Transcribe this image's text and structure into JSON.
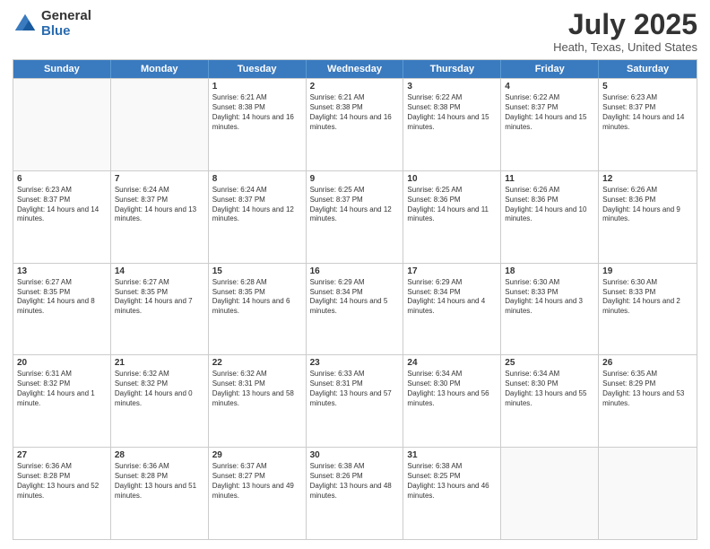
{
  "logo": {
    "general": "General",
    "blue": "Blue"
  },
  "title": {
    "month": "July 2025",
    "location": "Heath, Texas, United States"
  },
  "header": {
    "days": [
      "Sunday",
      "Monday",
      "Tuesday",
      "Wednesday",
      "Thursday",
      "Friday",
      "Saturday"
    ]
  },
  "rows": [
    [
      {
        "day": "",
        "info": "",
        "empty": true
      },
      {
        "day": "",
        "info": "",
        "empty": true
      },
      {
        "day": "1",
        "info": "Sunrise: 6:21 AM\nSunset: 8:38 PM\nDaylight: 14 hours and 16 minutes."
      },
      {
        "day": "2",
        "info": "Sunrise: 6:21 AM\nSunset: 8:38 PM\nDaylight: 14 hours and 16 minutes."
      },
      {
        "day": "3",
        "info": "Sunrise: 6:22 AM\nSunset: 8:38 PM\nDaylight: 14 hours and 15 minutes."
      },
      {
        "day": "4",
        "info": "Sunrise: 6:22 AM\nSunset: 8:37 PM\nDaylight: 14 hours and 15 minutes."
      },
      {
        "day": "5",
        "info": "Sunrise: 6:23 AM\nSunset: 8:37 PM\nDaylight: 14 hours and 14 minutes."
      }
    ],
    [
      {
        "day": "6",
        "info": "Sunrise: 6:23 AM\nSunset: 8:37 PM\nDaylight: 14 hours and 14 minutes."
      },
      {
        "day": "7",
        "info": "Sunrise: 6:24 AM\nSunset: 8:37 PM\nDaylight: 14 hours and 13 minutes."
      },
      {
        "day": "8",
        "info": "Sunrise: 6:24 AM\nSunset: 8:37 PM\nDaylight: 14 hours and 12 minutes."
      },
      {
        "day": "9",
        "info": "Sunrise: 6:25 AM\nSunset: 8:37 PM\nDaylight: 14 hours and 12 minutes."
      },
      {
        "day": "10",
        "info": "Sunrise: 6:25 AM\nSunset: 8:36 PM\nDaylight: 14 hours and 11 minutes."
      },
      {
        "day": "11",
        "info": "Sunrise: 6:26 AM\nSunset: 8:36 PM\nDaylight: 14 hours and 10 minutes."
      },
      {
        "day": "12",
        "info": "Sunrise: 6:26 AM\nSunset: 8:36 PM\nDaylight: 14 hours and 9 minutes."
      }
    ],
    [
      {
        "day": "13",
        "info": "Sunrise: 6:27 AM\nSunset: 8:35 PM\nDaylight: 14 hours and 8 minutes."
      },
      {
        "day": "14",
        "info": "Sunrise: 6:27 AM\nSunset: 8:35 PM\nDaylight: 14 hours and 7 minutes."
      },
      {
        "day": "15",
        "info": "Sunrise: 6:28 AM\nSunset: 8:35 PM\nDaylight: 14 hours and 6 minutes."
      },
      {
        "day": "16",
        "info": "Sunrise: 6:29 AM\nSunset: 8:34 PM\nDaylight: 14 hours and 5 minutes."
      },
      {
        "day": "17",
        "info": "Sunrise: 6:29 AM\nSunset: 8:34 PM\nDaylight: 14 hours and 4 minutes."
      },
      {
        "day": "18",
        "info": "Sunrise: 6:30 AM\nSunset: 8:33 PM\nDaylight: 14 hours and 3 minutes."
      },
      {
        "day": "19",
        "info": "Sunrise: 6:30 AM\nSunset: 8:33 PM\nDaylight: 14 hours and 2 minutes."
      }
    ],
    [
      {
        "day": "20",
        "info": "Sunrise: 6:31 AM\nSunset: 8:32 PM\nDaylight: 14 hours and 1 minute."
      },
      {
        "day": "21",
        "info": "Sunrise: 6:32 AM\nSunset: 8:32 PM\nDaylight: 14 hours and 0 minutes."
      },
      {
        "day": "22",
        "info": "Sunrise: 6:32 AM\nSunset: 8:31 PM\nDaylight: 13 hours and 58 minutes."
      },
      {
        "day": "23",
        "info": "Sunrise: 6:33 AM\nSunset: 8:31 PM\nDaylight: 13 hours and 57 minutes."
      },
      {
        "day": "24",
        "info": "Sunrise: 6:34 AM\nSunset: 8:30 PM\nDaylight: 13 hours and 56 minutes."
      },
      {
        "day": "25",
        "info": "Sunrise: 6:34 AM\nSunset: 8:30 PM\nDaylight: 13 hours and 55 minutes."
      },
      {
        "day": "26",
        "info": "Sunrise: 6:35 AM\nSunset: 8:29 PM\nDaylight: 13 hours and 53 minutes."
      }
    ],
    [
      {
        "day": "27",
        "info": "Sunrise: 6:36 AM\nSunset: 8:28 PM\nDaylight: 13 hours and 52 minutes."
      },
      {
        "day": "28",
        "info": "Sunrise: 6:36 AM\nSunset: 8:28 PM\nDaylight: 13 hours and 51 minutes."
      },
      {
        "day": "29",
        "info": "Sunrise: 6:37 AM\nSunset: 8:27 PM\nDaylight: 13 hours and 49 minutes."
      },
      {
        "day": "30",
        "info": "Sunrise: 6:38 AM\nSunset: 8:26 PM\nDaylight: 13 hours and 48 minutes."
      },
      {
        "day": "31",
        "info": "Sunrise: 6:38 AM\nSunset: 8:25 PM\nDaylight: 13 hours and 46 minutes."
      },
      {
        "day": "",
        "info": "",
        "empty": true
      },
      {
        "day": "",
        "info": "",
        "empty": true
      }
    ]
  ]
}
